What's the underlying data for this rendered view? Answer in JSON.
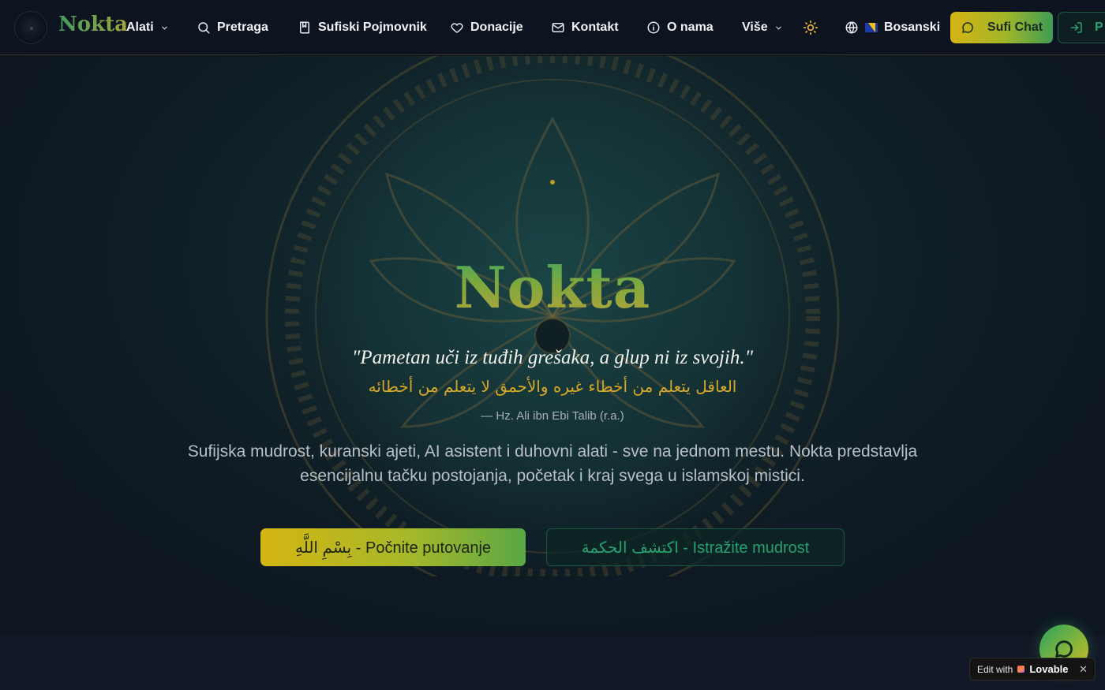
{
  "nav": {
    "brand": "Nokta",
    "items": [
      {
        "label": "Alati"
      },
      {
        "label": "Pretraga"
      },
      {
        "label": "Sufiski Pojmovnik"
      },
      {
        "label": "Donacije"
      },
      {
        "label": "Kontakt"
      },
      {
        "label": "O nama"
      },
      {
        "label": "Više"
      }
    ],
    "language": "Bosanski",
    "chat_button": "Sufi Chat",
    "login_button": "P"
  },
  "hero": {
    "title": "Nokta",
    "quote": "\"Pametan uči iz tuđih grešaka, a glup ni iz svojih.\"",
    "arabic_quote": "العاقل يتعلم من أخطاء غيره والأحمق لا يتعلم من أخطائه",
    "author": "— Hz. Ali ibn Ebi Talib (r.a.)",
    "description": "Sufijska mudrost, kuranski ajeti, AI asistent i duhovni alati - sve na jednom mestu. Nokta predstavlja esencijalnu tačku postojanja, početak i kraj svega u islamskoj mistici.",
    "primary_cta": "بِسْمِ اللَّهِ - Počnite putovanje",
    "secondary_cta": "اكتشف الحكمة - Istražite mudrost"
  },
  "badge": {
    "edit_with": "Edit with",
    "brand": "Lovable",
    "close": "✕"
  },
  "colors": {
    "accent_gold": "#d4b513",
    "accent_green": "#2aa274",
    "background": "#0f1724"
  },
  "icons": [
    "logo-mark",
    "chevron-down-icon",
    "search-icon",
    "book-icon",
    "heart-icon",
    "mail-icon",
    "info-icon",
    "sun-icon",
    "globe-icon",
    "flag-icon",
    "chat-bubble-icon",
    "login-icon"
  ]
}
